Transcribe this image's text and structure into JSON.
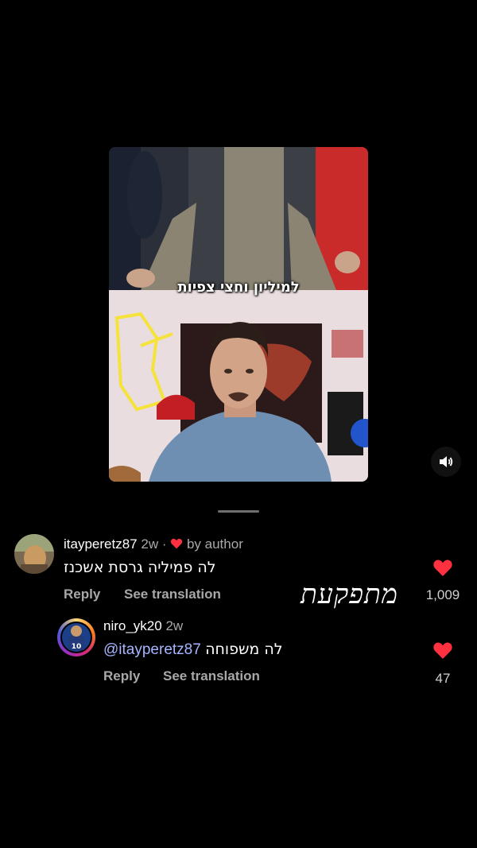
{
  "video": {
    "caption": "למיליון וחצי צפיות"
  },
  "comments": [
    {
      "username": "itayperetz87",
      "time": "2w",
      "separator": "·",
      "author_badge": "by author",
      "text": "לה פמיליה גרסת אשכנז",
      "reply_label": "Reply",
      "translate_label": "See translation",
      "likes": "1,009"
    },
    {
      "username": "niro_yk20",
      "time": "2w",
      "mention": "@itayperetz87",
      "text": "לה משפוחה",
      "reply_label": "Reply",
      "translate_label": "See translation",
      "likes": "47"
    }
  ],
  "overlay_handwriting": "מתפקעת",
  "colors": {
    "background": "#000000",
    "heart": "#ff3040",
    "secondary_text": "#a8a8a8",
    "mention": "#a7b6ff"
  },
  "icons": [
    "speaker-icon",
    "heart-icon",
    "avatar"
  ]
}
